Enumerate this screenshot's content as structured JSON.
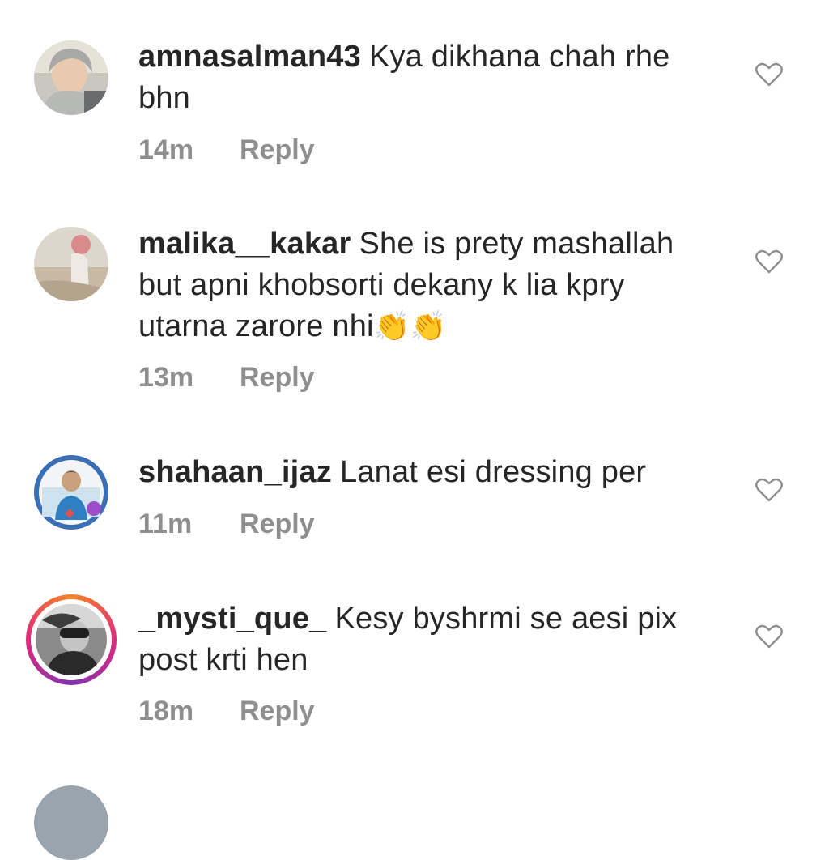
{
  "comments": [
    {
      "username": "amnasalman43",
      "text": "Kya dikhana chah rhe bhn",
      "time": "14m",
      "reply_label": "Reply"
    },
    {
      "username": "malika__kakar",
      "text": "She is prety mashallah but apni khobsorti dekany k lia kpry utarna zarore nhi",
      "emoji": "👏👏",
      "time": "13m",
      "reply_label": "Reply"
    },
    {
      "username": "shahaan_ijaz",
      "text": "Lanat esi dressing per",
      "time": "11m",
      "reply_label": "Reply"
    },
    {
      "username": "_mysti_que_",
      "text": "Kesy byshrmi se aesi pix post krti hen",
      "time": "18m",
      "reply_label": "Reply"
    }
  ],
  "icons": {
    "like": "heart-outline-icon"
  },
  "colors": {
    "text": "#262626",
    "meta": "#8e8e8e"
  }
}
